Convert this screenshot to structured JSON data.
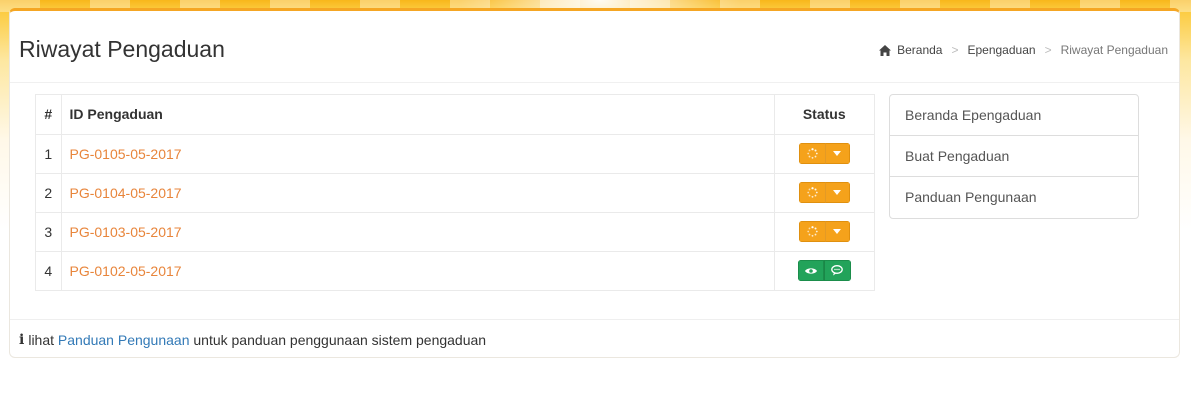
{
  "page": {
    "title": "Riwayat Pengaduan"
  },
  "breadcrumb": {
    "home": "Beranda",
    "middle": "Epengaduan",
    "current": "Riwayat Pengaduan",
    "separator": ">"
  },
  "table": {
    "headers": {
      "num": "#",
      "id": "ID Pengaduan",
      "status": "Status"
    },
    "rows": [
      {
        "num": "1",
        "id": "PG-0105-05-2017",
        "status_type": "pending"
      },
      {
        "num": "2",
        "id": "PG-0104-05-2017",
        "status_type": "pending"
      },
      {
        "num": "3",
        "id": "PG-0103-05-2017",
        "status_type": "pending"
      },
      {
        "num": "4",
        "id": "PG-0102-05-2017",
        "status_type": "answered"
      }
    ]
  },
  "side_nav": {
    "items": [
      "Beranda Epengaduan",
      "Buat Pengaduan",
      "Panduan Pengunaan"
    ]
  },
  "footer": {
    "prefix": "lihat",
    "link": "Panduan Pengunaan",
    "suffix": "untuk panduan penggunaan sistem pengaduan"
  },
  "colors": {
    "accent": "#f5a21b",
    "link_orange": "#e8853b",
    "success": "#22a35a",
    "link_blue": "#337ab7"
  },
  "icons": {
    "home": "home-icon",
    "pending": "spinner-icon",
    "dropdown": "caret-down-icon",
    "view": "eye-icon",
    "comment": "comment-icon",
    "info": "info-icon"
  }
}
